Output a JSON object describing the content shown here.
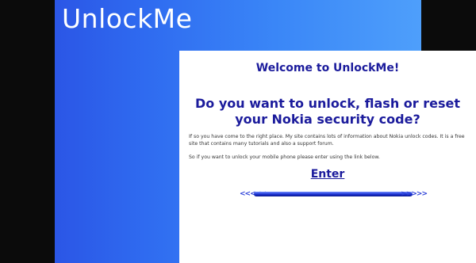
{
  "site": {
    "title": "UnlockMe"
  },
  "content": {
    "welcome": "Welcome to UnlockMe!",
    "question": "Do you want to unlock, flash or reset your Nokia security code?",
    "paragraph_1": "If so you have come to the right place. My site contains lots of information about Nokia unlock codes. It is a free site that contains many tutorials and also a support forum.",
    "paragraph_2": "So if you want to unlock your mobile phone please enter using the link below.",
    "enter_label": "Enter"
  },
  "divider": {
    "left_arrows": "<<<<<",
    "right_arrows": ">>>>>"
  },
  "colors": {
    "brand_blue": "#2f6bf0",
    "heading_blue": "#1b1b9c",
    "background": "#0b0b0b"
  }
}
